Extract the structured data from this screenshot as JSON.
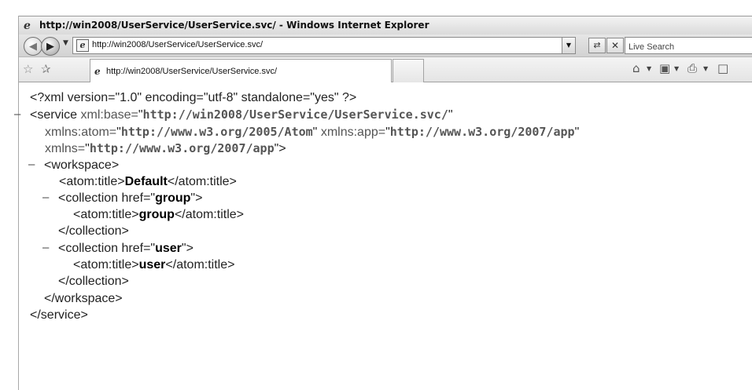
{
  "window": {
    "title": "http://win2008/UserService/UserService.svc/ - Windows Internet Explorer"
  },
  "navbar": {
    "address_url": "http://win2008/UserService/UserService.svc/",
    "search_placeholder": "Live Search"
  },
  "tabs": [
    {
      "label": "http://win2008/UserService/UserService.svc/"
    }
  ],
  "xml": {
    "declaration": "<?xml version=\"1.0\" encoding=\"utf-8\" standalone=\"yes\" ?>",
    "service_open_tag": "<service",
    "xml_base_attr": "xml:base=",
    "xml_base_value": "http://win2008/UserService/UserService.svc/",
    "atom_attr": "xmlns:atom=",
    "atom_value": "http://www.w3.org/2005/Atom",
    "app_attr": "xmlns:app=",
    "app_value": "http://www.w3.org/2007/app",
    "xmlns_attr": "xmlns=",
    "xmlns_value": "http://www.w3.org/2007/app",
    "workspace_open": "<workspace>",
    "atom_title_open": "<atom:title>",
    "atom_title_close": "</atom:title>",
    "workspace_title": "Default",
    "collection_open": "<collection href=",
    "collection_close": "</collection>",
    "collections": [
      {
        "href": "group",
        "title": "group"
      },
      {
        "href": "user",
        "title": "user"
      }
    ],
    "workspace_close": "</workspace>",
    "service_close": "</service>",
    "collapse_marker": "–"
  },
  "colors": {
    "window_bg": "#ffffff",
    "chrome_gray": "#dcdcdc"
  }
}
